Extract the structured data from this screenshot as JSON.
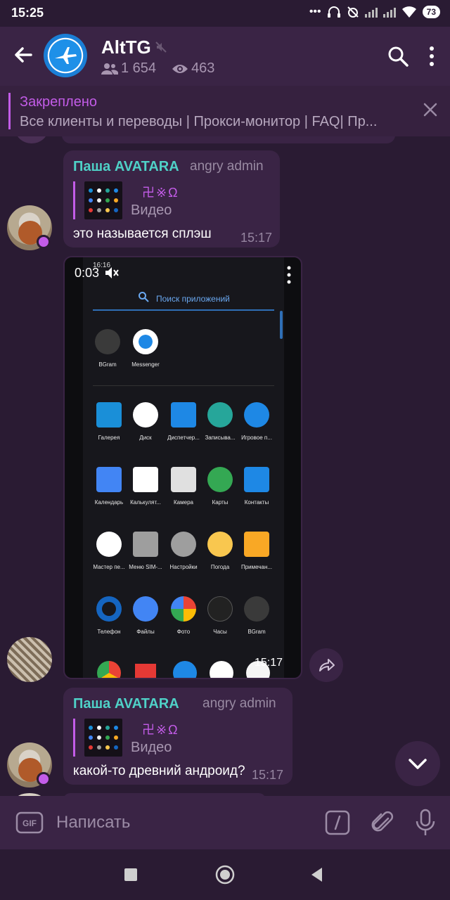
{
  "status_bar": {
    "time": "15:25",
    "battery": "73"
  },
  "header": {
    "title": "AltTG",
    "subscribers": "1 654",
    "views": "463"
  },
  "pinned": {
    "title": "Закреплено",
    "text": "Все клиенты и переводы | Прокси-монитор | FAQ| Пр..."
  },
  "messages": [
    {
      "sender": "Паша AVATARA",
      "role": "angry admin",
      "reply_name": "卍※Ω",
      "reply_type": "Видео",
      "text": "это называется сплэш",
      "time": "15:17"
    },
    {
      "video": {
        "duration": "0:03",
        "time": "15:17",
        "status_time": "16:16",
        "search_placeholder": "Поиск приложений",
        "apps_row1": [
          {
            "label": "BGram",
            "color": "#3a3a3a"
          },
          {
            "label": "Messenger",
            "color": "#ffffff"
          }
        ],
        "apps_grid": [
          {
            "label": "Галерея",
            "color": "#1a8fd8"
          },
          {
            "label": "Диск",
            "color": "#ffffff"
          },
          {
            "label": "Диспетчер...",
            "color": "#1e88e5"
          },
          {
            "label": "Записыва...",
            "color": "#26a69a"
          },
          {
            "label": "Игровое п...",
            "color": "#1e88e5"
          },
          {
            "label": "Календарь",
            "color": "#4285f4"
          },
          {
            "label": "Калькулят...",
            "color": "#ffffff"
          },
          {
            "label": "Камера",
            "color": "#e0e0e0"
          },
          {
            "label": "Карты",
            "color": "#34a853"
          },
          {
            "label": "Контакты",
            "color": "#1e88e5"
          },
          {
            "label": "Мастер пе...",
            "color": "#ffffff"
          },
          {
            "label": "Меню SIM-...",
            "color": "#9e9e9e"
          },
          {
            "label": "Настройки",
            "color": "#9e9e9e"
          },
          {
            "label": "Погода",
            "color": "#f9c74f"
          },
          {
            "label": "Примечан...",
            "color": "#f9a825"
          },
          {
            "label": "Телефон",
            "color": "#1565c0"
          },
          {
            "label": "Файлы",
            "color": "#4285f4"
          },
          {
            "label": "Фото",
            "color": "#ffffff"
          },
          {
            "label": "Часы",
            "color": "#222222"
          },
          {
            "label": "BGram",
            "color": "#3a3a3a"
          }
        ]
      }
    },
    {
      "sender": "Паша AVATARA",
      "role": "angry admin",
      "reply_name": "卍※Ω",
      "reply_type": "Видео",
      "text": "какой-то древний андроид?",
      "time": "15:17"
    }
  ],
  "input": {
    "placeholder": "Написать",
    "gif_label": "GIF"
  },
  "colors": {
    "accent": "#c35ce8",
    "sender": "#4fd1c7",
    "bubble": "#3a2445",
    "background": "#2a1b33"
  }
}
